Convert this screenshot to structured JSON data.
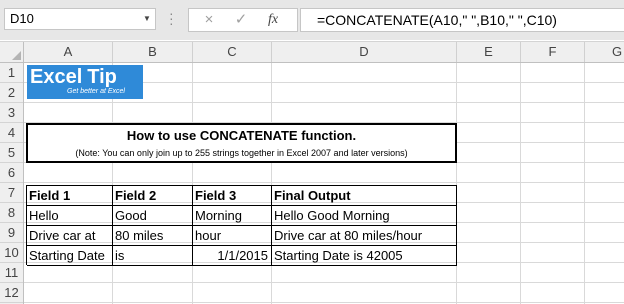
{
  "formula_bar": {
    "name_box": "D10",
    "cancel_icon": "×",
    "enter_icon": "✓",
    "fx_icon": "fx",
    "formula": "=CONCATENATE(A10,\" \",B10,\" \",C10)"
  },
  "columns": [
    "A",
    "B",
    "C",
    "D",
    "E",
    "F",
    "G"
  ],
  "rows": [
    "1",
    "2",
    "3",
    "4",
    "5",
    "6",
    "7",
    "8",
    "9",
    "10",
    "11",
    "12"
  ],
  "logo": {
    "main": "Excel",
    "tip": "Tip",
    "tagline": "Get better at Excel"
  },
  "title_box": {
    "title": "How to use CONCATENATE function.",
    "note": "(Note: You can only join up to 255 strings together in Excel 2007 and later versions)"
  },
  "table": {
    "headers": [
      "Field 1",
      "Field 2",
      "Field 3",
      "Final Output"
    ],
    "rows": [
      [
        "Hello",
        "Good",
        "Morning",
        "Hello Good Morning"
      ],
      [
        "Drive car at",
        "80 miles",
        "hour",
        "Drive car at 80 miles/hour"
      ],
      [
        "Starting Date",
        "is",
        "1/1/2015",
        "Starting Date is 42005"
      ]
    ]
  }
}
